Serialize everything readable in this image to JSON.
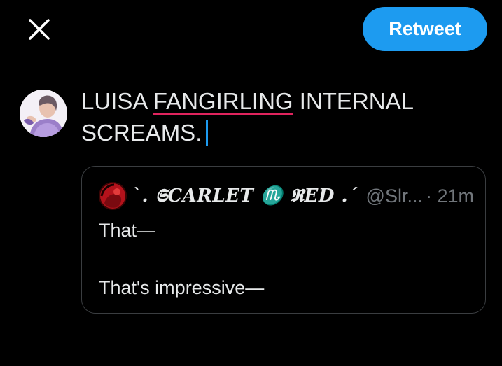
{
  "header": {
    "close_icon": "close-icon",
    "retweet_label": "Retweet"
  },
  "composer": {
    "avatar_icon": "user-avatar",
    "text_part1": "LUISA ",
    "text_misspelled": "FANGIRLING",
    "text_part2": " INTERNAL SCREAMS."
  },
  "quoted_tweet": {
    "avatar_icon": "quoted-user-avatar",
    "display_name": "`. 𝕾CARLET ♏ 𝕽ED .´",
    "handle": "@Slr...",
    "time": "· 21m",
    "lines": [
      "That—",
      "That's impressive—"
    ]
  },
  "colors": {
    "background": "#000000",
    "accent": "#1d9bf0",
    "text": "#e7e9ea",
    "muted": "#71767b",
    "spellcheck_underline": "#e0245e"
  }
}
